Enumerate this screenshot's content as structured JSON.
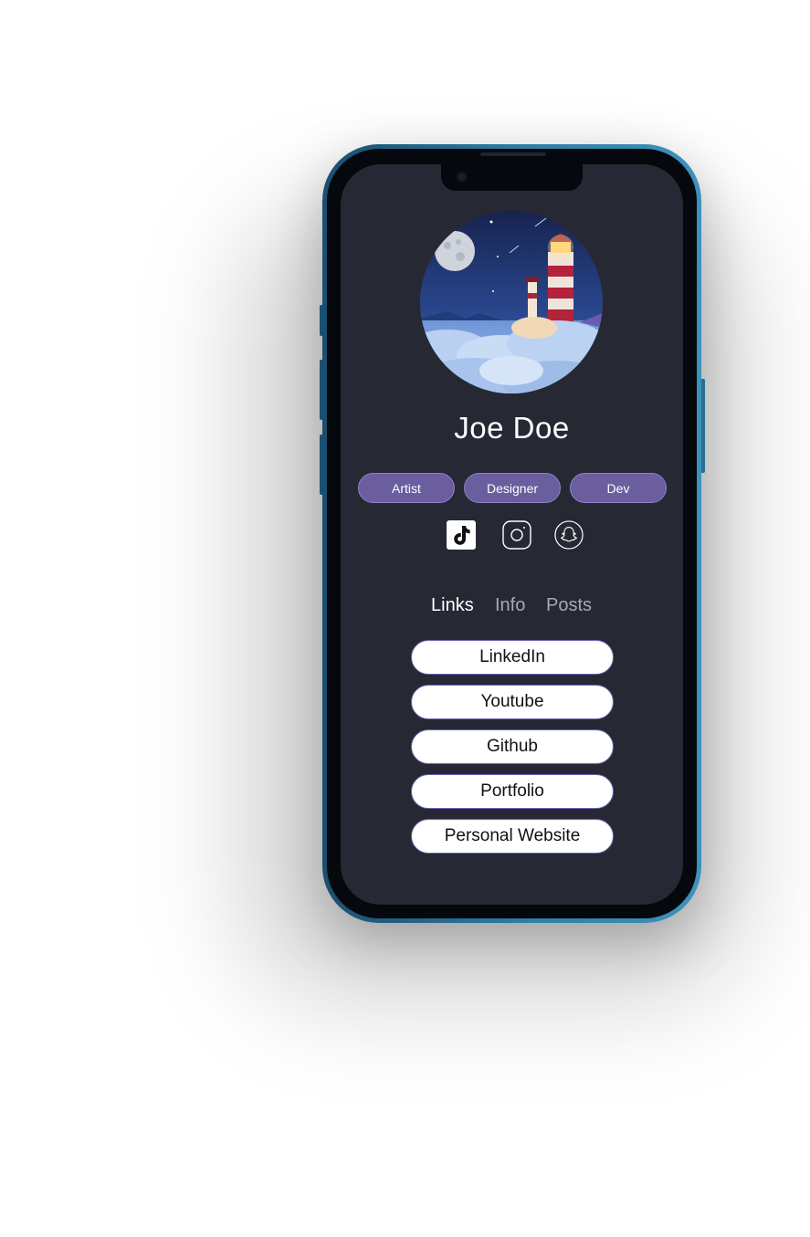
{
  "profile": {
    "name": "Joe Doe",
    "avatar_icon": "lighthouse-night-avatar",
    "tags": [
      "Artist",
      "Designer",
      "Dev"
    ]
  },
  "socials": [
    {
      "icon": "tiktok-icon"
    },
    {
      "icon": "instagram-icon"
    },
    {
      "icon": "snapchat-icon"
    }
  ],
  "tabs": {
    "links": "Links",
    "info": "Info",
    "posts": "Posts",
    "active": "Links"
  },
  "links": [
    "LinkedIn",
    "Youtube",
    "Github",
    "Portfolio",
    "Personal Website"
  ],
  "colors": {
    "screen_bg": "#262834",
    "tag_bg": "#6a5e9e",
    "frame": "#2f7fa6",
    "link_bg": "#ffffff",
    "inactive_tab": "#a8a9b2"
  }
}
